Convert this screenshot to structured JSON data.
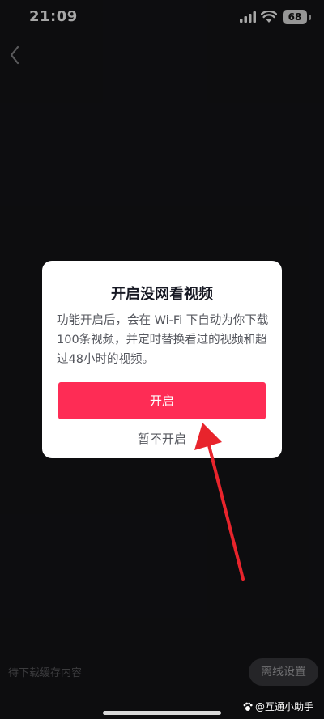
{
  "status_bar": {
    "time": "21:09",
    "battery": "68",
    "icons": [
      "signal-icon",
      "wifi-icon",
      "battery-icon"
    ]
  },
  "navigation": {
    "back_icon": "chevron-left-icon"
  },
  "page": {
    "pending_label": "待下载缓存内容",
    "offline_settings_label": "离线设置"
  },
  "dialog": {
    "title": "开启没网看视频",
    "message": "功能开启后，会在 Wi-Fi 下自动为你下载100条视频，并定时替换看过的视频和超过48小时的视频。",
    "confirm_label": "开启",
    "cancel_label": "暂不开启"
  },
  "watermark": {
    "text": "@互通小助手"
  },
  "colors": {
    "accent": "#fe2c55",
    "annotation": "#e8242c",
    "background": "#141418"
  }
}
